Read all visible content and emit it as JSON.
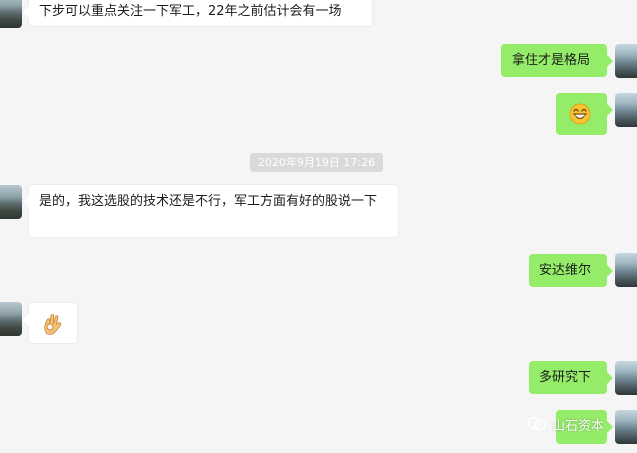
{
  "chat": {
    "messages": [
      {
        "id": "m1",
        "side": "left",
        "text": "下步可以重点关注一下军工，22年之前估计会有一场"
      },
      {
        "id": "m2",
        "side": "right",
        "text": "拿住才是格局"
      },
      {
        "id": "m3",
        "side": "right",
        "emoji": "grinning-face"
      },
      {
        "id": "m5",
        "side": "left",
        "text": "是的，我这选股的技术还是不行，军工方面有好的股说一下"
      },
      {
        "id": "m6",
        "side": "right",
        "text": "安达维尔"
      },
      {
        "id": "m7",
        "side": "left",
        "emoji": "ok-hand"
      },
      {
        "id": "m8",
        "side": "right",
        "text": "多研究下"
      },
      {
        "id": "m9",
        "side": "right",
        "emoji": "unknown"
      }
    ],
    "timestamp": "2020年9月19日 17:26"
  },
  "watermark": {
    "text": "山石资本",
    "icon": "wechat-channel-icon"
  },
  "colors": {
    "background": "#f5f5f5",
    "incoming_bubble": "#ffffff",
    "outgoing_bubble": "#95ec69",
    "timestamp_pill": "#dadada"
  }
}
